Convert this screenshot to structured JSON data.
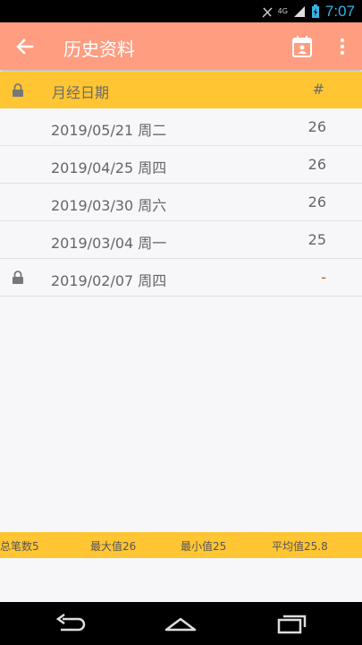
{
  "status": {
    "network": "4G",
    "time": "7:07"
  },
  "appbar": {
    "title": "历史资料"
  },
  "header": {
    "date_col": "月经日期",
    "count_col": "#"
  },
  "rows": [
    {
      "date": "2019/05/21 周二",
      "count": "26",
      "locked": false
    },
    {
      "date": "2019/04/25 周四",
      "count": "26",
      "locked": false
    },
    {
      "date": "2019/03/30 周六",
      "count": "26",
      "locked": false
    },
    {
      "date": "2019/03/04 周一",
      "count": "25",
      "locked": false
    },
    {
      "date": "2019/02/07 周四",
      "count": "-",
      "locked": true
    }
  ],
  "stats": {
    "total": "总笔数5",
    "max": "最大值26",
    "min": "最小值25",
    "avg": "平均值25.8"
  },
  "colors": {
    "appbar": "#ff9d80",
    "header": "#ffc533",
    "dash": "#d9442e"
  },
  "icons": [
    "back-arrow-icon",
    "calendar-icon",
    "more-vert-icon",
    "lock-icon",
    "nav-back-icon",
    "nav-home-icon",
    "nav-recents-icon"
  ]
}
